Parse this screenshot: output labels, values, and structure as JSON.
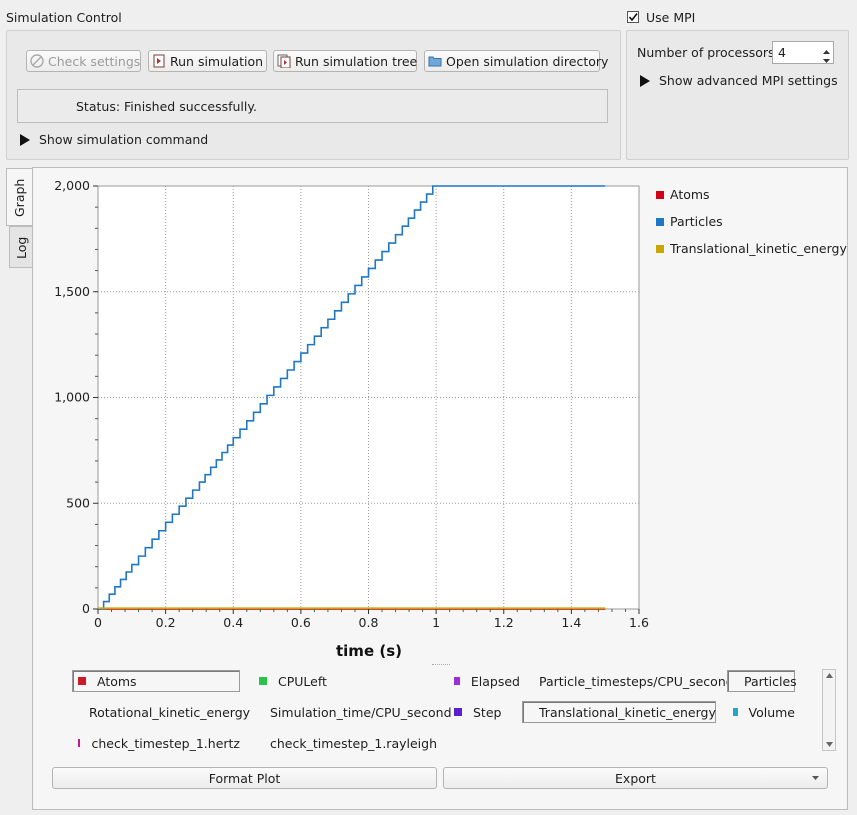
{
  "sim_control": {
    "title": "Simulation Control",
    "buttons": {
      "check": "Check settings",
      "run": "Run simulation",
      "run_tree": "Run simulation tree",
      "open_dir": "Open simulation directory"
    },
    "status": "Status: Finished successfully.",
    "show_command": "Show simulation command"
  },
  "mpi": {
    "use_label": "Use MPI",
    "checked": true,
    "processors_label": "Number of processors:",
    "processors_value": "4",
    "advanced": "Show advanced MPI settings"
  },
  "tabs": [
    {
      "label": "Graph",
      "active": true
    },
    {
      "label": "Log",
      "active": false
    }
  ],
  "chart_data": {
    "type": "line",
    "xlabel": "time (s)",
    "ylabel": "",
    "xlim": [
      0,
      1.6
    ],
    "ylim": [
      0,
      2000
    ],
    "x_ticks": [
      "0",
      "0.2",
      "0.4",
      "0.6",
      "0.8",
      "1",
      "1.2",
      "1.4",
      "1.6"
    ],
    "y_ticks": [
      "0",
      "500",
      "1,000",
      "1,500",
      "2,000"
    ],
    "grid": true,
    "legend_position": "right",
    "series": [
      {
        "name": "Atoms",
        "color": "#d0021b",
        "x": [
          0,
          1.5
        ],
        "y": [
          0,
          0
        ]
      },
      {
        "name": "Particles",
        "color": "#1f77c4",
        "x": [
          0,
          0.1,
          0.2,
          0.3,
          0.4,
          0.5,
          0.6,
          0.7,
          0.8,
          0.9,
          0.99,
          1.2,
          1.5
        ],
        "y": [
          0,
          210,
          410,
          600,
          810,
          1010,
          1210,
          1410,
          1610,
          1810,
          2000,
          2000,
          2000
        ]
      },
      {
        "name": "Translational_kinetic_energy",
        "color": "#c8a800",
        "x": [
          0,
          1.5
        ],
        "y": [
          4,
          4
        ]
      }
    ]
  },
  "bottom_legend": [
    {
      "label": "Atoms",
      "color": "#cc1a2a",
      "selected": true
    },
    {
      "label": "CPULeft",
      "color": "#2bc44a",
      "selected": false
    },
    {
      "label": "Elapsed",
      "color": "#9b2fd6",
      "selected": false
    },
    {
      "label": "Particle_timesteps/CPU_second",
      "color": "#c9c922",
      "selected": false
    },
    {
      "label": "Particles",
      "color": "#1f77c4",
      "selected": true
    },
    {
      "label": "Rotational_kinetic_energy",
      "color": "#b0153c",
      "selected": false
    },
    {
      "label": "Simulation_time/CPU_second",
      "color": "#35b735",
      "selected": false
    },
    {
      "label": "Step",
      "color": "#5b1fd0",
      "selected": false
    },
    {
      "label": "Translational_kinetic_energy",
      "color": "#c8a000",
      "selected": true
    },
    {
      "label": "Volume",
      "color": "#1fa9c9",
      "selected": false
    },
    {
      "label": "check_timestep_1.hertz",
      "color": "#c21a8a",
      "selected": false
    },
    {
      "label": "check_timestep_1.rayleigh",
      "color": "#4cc42a",
      "selected": false
    }
  ],
  "actions": {
    "format_plot": "Format Plot",
    "export": "Export"
  }
}
